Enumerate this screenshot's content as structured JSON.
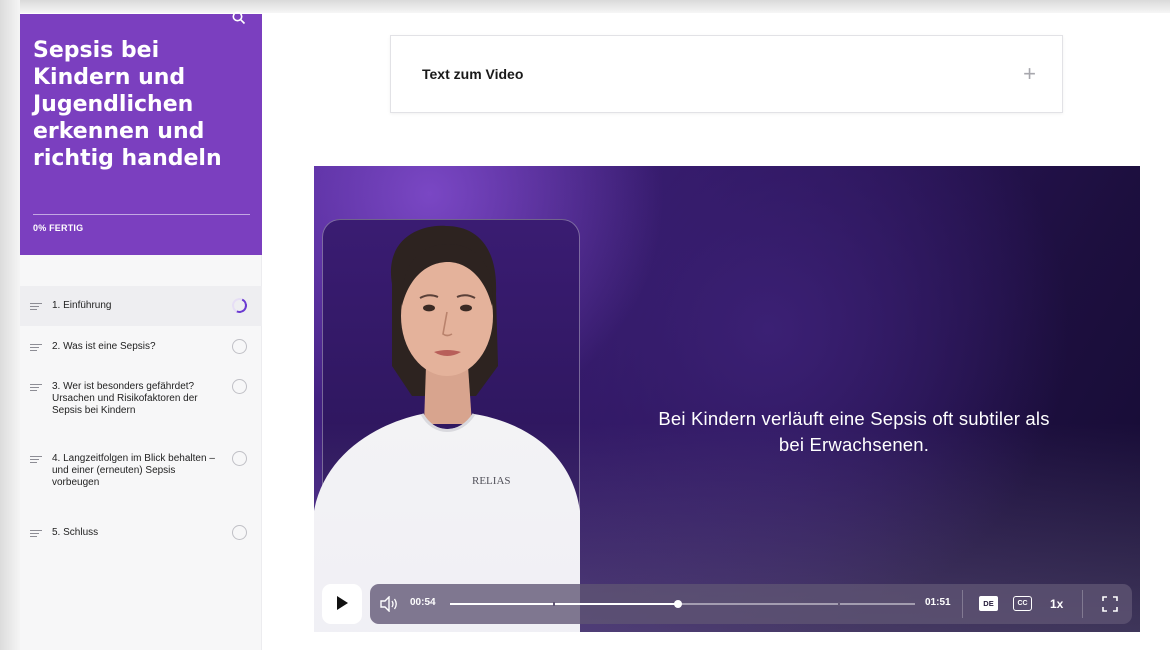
{
  "sidebar": {
    "course_title": "Sepsis bei Kindern und Jugendlichen erkennen und richtig handeln",
    "progress_label": "0% FERTIG",
    "lessons": [
      {
        "label": "1. Einführung",
        "status": "in-progress"
      },
      {
        "label": "2. Was ist eine Sepsis?",
        "status": "not-started"
      },
      {
        "label": "3. Wer ist besonders gefährdet? Ursachen und Risikofaktoren der Sepsis bei Kindern",
        "status": "not-started"
      },
      {
        "label": "4. Langzeitfolgen im Blick behalten – und einer (erneuten) Sepsis vorbeugen",
        "status": "not-started"
      },
      {
        "label": "5. Schluss",
        "status": "not-started"
      }
    ]
  },
  "accordion": {
    "title": "Text zum Video",
    "toggle": "+"
  },
  "video": {
    "subtitle": "Bei Kindern verläuft eine Sepsis oft subtiler als bei Erwachsenen.",
    "shirt_logo": "RELIAS",
    "controls": {
      "current_time": "00:54",
      "total_time": "01:51",
      "progress_fraction": 0.49,
      "language": "DE",
      "cc": "CC",
      "speed": "1x"
    }
  },
  "icons": [
    "search-icon",
    "drag-handle-icon",
    "status-circle-icon",
    "play-icon",
    "volume-icon",
    "fullscreen-icon"
  ],
  "colors": {
    "accent": "#7b3fbf",
    "progress_ring": "#6b3ad1"
  }
}
